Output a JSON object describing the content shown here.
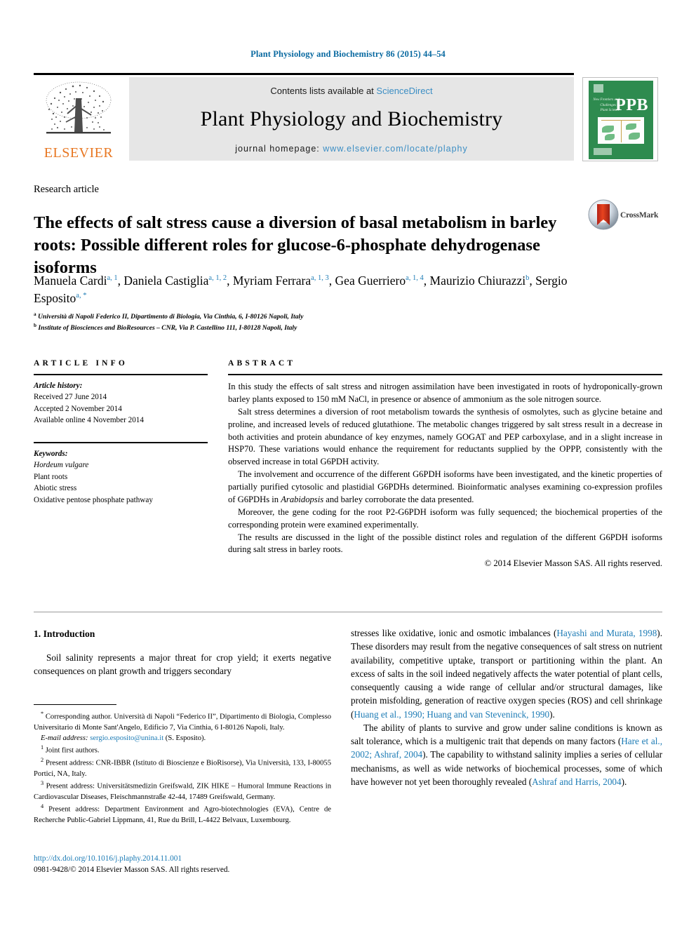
{
  "running_head": "Plant Physiology and Biochemistry 86 (2015) 44–54",
  "masthead": {
    "contents_prefix": "Contents lists available at ",
    "sciencedirect": "ScienceDirect",
    "journal_title": "Plant Physiology and Biochemistry",
    "homepage_prefix": "journal homepage: ",
    "homepage_url": "www.elsevier.com/locate/plaphy",
    "publisher_wordmark": "ELSEVIER",
    "publisher_color": "#e87722",
    "cover": {
      "acronym": "PPB",
      "subtitle": "New Frontiers and Challenges in Plant Science",
      "background_color": "#2e8b4f"
    }
  },
  "crossmark": {
    "label": "CrossMark"
  },
  "article": {
    "type": "Research article",
    "title": "The effects of salt stress cause a diversion of basal metabolism in barley roots: Possible different roles for glucose-6-phosphate dehydrogenase isoforms",
    "authors": [
      {
        "name": "Manuela Cardi",
        "marks": "a, 1"
      },
      {
        "name": "Daniela Castiglia",
        "marks": "a, 1, 2"
      },
      {
        "name": "Myriam Ferrara",
        "marks": "a, 1, 3"
      },
      {
        "name": "Gea Guerriero",
        "marks": "a, 1, 4"
      },
      {
        "name": "Maurizio Chiurazzi",
        "marks": "b"
      },
      {
        "name": "Sergio Esposito",
        "marks": "a, *"
      }
    ],
    "affiliations": [
      {
        "mark": "a",
        "text": "Università di Napoli Federico II, Dipartimento di Biologia, Via Cinthia, 6, I-80126 Napoli, Italy"
      },
      {
        "mark": "b",
        "text": "Institute of Biosciences and BioResources – CNR, Via P. Castellino 111, I-80128 Napoli, Italy"
      }
    ]
  },
  "article_info": {
    "heading": "ARTICLE INFO",
    "history_label": "Article history:",
    "history": [
      "Received 27 June 2014",
      "Accepted 2 November 2014",
      "Available online 4 November 2014"
    ],
    "keywords_label": "Keywords:",
    "keywords": [
      "Hordeum vulgare",
      "Plant roots",
      "Abiotic stress",
      "Oxidative pentose phosphate pathway"
    ]
  },
  "abstract": {
    "heading": "ABSTRACT",
    "paragraphs": [
      "In this study the effects of salt stress and nitrogen assimilation have been investigated in roots of hydroponically-grown barley plants exposed to 150 mM NaCl, in presence or absence of ammonium as the sole nitrogen source.",
      "Salt stress determines a diversion of root metabolism towards the synthesis of osmolytes, such as glycine betaine and proline, and increased levels of reduced glutathione. The metabolic changes triggered by salt stress result in a decrease in both activities and protein abundance of key enzymes, namely GOGAT and PEP carboxylase, and in a slight increase in HSP70. These variations would enhance the requirement for reductants supplied by the OPPP, consistently with the observed increase in total G6PDH activity.",
      "Moreover, the gene coding for the root P2-G6PDH isoform was fully sequenced; the biochemical properties of the corresponding protein were examined experimentally.",
      "The results are discussed in the light of the possible distinct roles and regulation of the different G6PDH isoforms during salt stress in barley roots."
    ],
    "bioinformatic_paragraph_pre": "The involvement and occurrence of the different G6PDH isoforms have been investigated, and the kinetic properties of partially purified cytosolic and plastidial G6PDHs determined. Bioinformatic analyses examining co-expression profiles of G6PDHs in ",
    "bioinformatic_italic": "Arabidopsis",
    "bioinformatic_paragraph_post": " and barley corroborate the data presented.",
    "copyright": "© 2014 Elsevier Masson SAS. All rights reserved."
  },
  "introduction": {
    "heading": "1. Introduction",
    "left_paragraph": "Soil salinity represents a major threat for crop yield; it exerts negative consequences on plant growth and triggers secondary",
    "right_p1_a": "stresses like oxidative, ionic and osmotic imbalances (",
    "right_p1_ref1": "Hayashi and Murata, 1998",
    "right_p1_b": "). These disorders may result from the negative consequences of salt stress on nutrient availability, competitive uptake, transport or partitioning within the plant. An excess of salts in the soil indeed negatively affects the water potential of plant cells, consequently causing a wide range of cellular and/or structural damages, like protein misfolding, generation of reactive oxygen species (ROS) and cell shrinkage (",
    "right_p1_ref2": "Huang et al., 1990; Huang and van Steveninck, 1990",
    "right_p1_c": ").",
    "right_p2_a": "The ability of plants to survive and grow under saline conditions is known as salt tolerance, which is a multigenic trait that depends on many factors (",
    "right_p2_ref1": "Hare et al., 2002; Ashraf, 2004",
    "right_p2_b": "). The capability to withstand salinity implies a series of cellular mechanisms, as well as wide networks of biochemical processes, some of which have however not yet been thoroughly revealed (",
    "right_p2_ref2": "Ashraf and Harris, 2004",
    "right_p2_c": ")."
  },
  "footnotes": {
    "corresponding_mark": "*",
    "corresponding": "Corresponding author. Università di Napoli “Federico II”, Dipartimento di Biologia, Complesso Universitario di Monte Sant'Angelo, Edificio 7, Via Cinthia, 6 I-80126 Napoli, Italy.",
    "email_label": "E-mail address:",
    "email": "sergio.esposito@unina.it",
    "email_owner": "(S. Esposito).",
    "items": [
      {
        "mark": "1",
        "text": "Joint first authors."
      },
      {
        "mark": "2",
        "text": "Present address: CNR-IBBR (Istituto di Bioscienze e BioRisorse), Via Università, 133, I-80055 Portici, NA, Italy."
      },
      {
        "mark": "3",
        "text": "Present address: Universitätsmedizin Greifswald, ZIK HIKE – Humoral Immune Reactions in Cardiovascular Diseases, Fleischmannstraße 42-44, 17489 Greifswald, Germany."
      },
      {
        "mark": "4",
        "text": "Present address: Department Environment and Agro-biotechnologies (EVA), Centre de Recherche Public-Gabriel Lippmann, 41, Rue du Brill, L-4422 Belvaux, Luxembourg."
      }
    ]
  },
  "footer": {
    "doi": "http://dx.doi.org/10.1016/j.plaphy.2014.11.001",
    "issn_line": "0981-9428/© 2014 Elsevier Masson SAS. All rights reserved."
  },
  "colors": {
    "link_blue": "#1c7bb5",
    "sciencedirect_blue": "#3c8ec4",
    "elsevier_orange": "#e87722",
    "cover_green": "#2e8b4f"
  }
}
